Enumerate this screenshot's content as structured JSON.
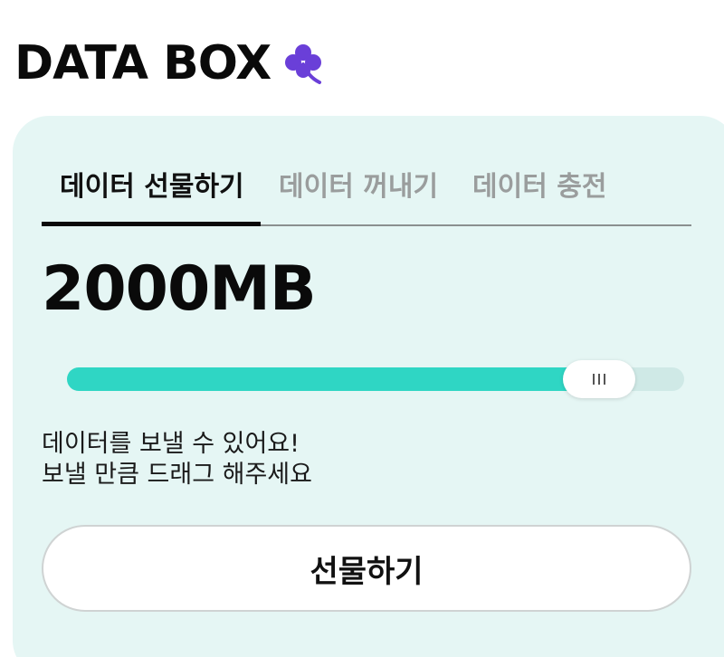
{
  "brand": {
    "title": "DATA BOX",
    "icon": "clover-icon",
    "icon_color": "#6a3fd8"
  },
  "tabs": [
    {
      "label": "데이터 선물하기",
      "active": true
    },
    {
      "label": "데이터 꺼내기",
      "active": false
    },
    {
      "label": "데이터 충전",
      "active": false
    }
  ],
  "amount": "2000MB",
  "slider": {
    "fill_fraction": 0.9,
    "fill_color": "#2fd6c4",
    "thumb_icon": "drag-grip-icon"
  },
  "message": {
    "line1": "데이터를 보낼 수 있어요!",
    "line2": "보낼 만큼 드래그 해주세요"
  },
  "button": {
    "label": "선물하기"
  },
  "colors": {
    "card_background": "#e5f6f4",
    "accent": "#2fd6c4"
  }
}
